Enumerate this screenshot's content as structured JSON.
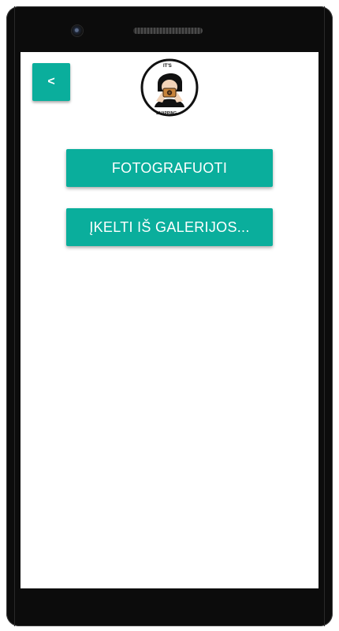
{
  "header": {
    "back_label": "<",
    "logo": {
      "icon": "person-with-camera-logo",
      "top_text": "IT'S",
      "bottom_text": "SNAPPING"
    }
  },
  "actions": {
    "take_photo_label": "FOTOGRAFUOTI",
    "upload_gallery_label": "ĮKELTI IŠ GALERIJOS..."
  },
  "colors": {
    "accent": "#0aae9c",
    "device_frame": "#0c0c0c",
    "screen_bg": "#ffffff"
  }
}
